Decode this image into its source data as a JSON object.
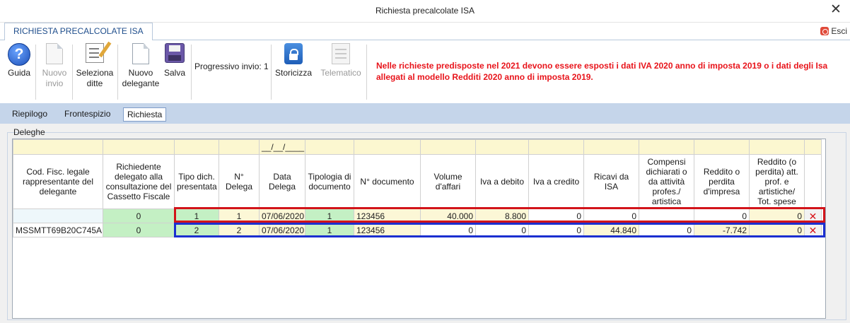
{
  "window": {
    "title": "Richiesta precalcolate ISA",
    "close_glyph": "✕"
  },
  "ribbon_tab": "RICHIESTA PRECALCOLATE ISA",
  "exit_label": "Esci",
  "toolbar": {
    "guida": "Guida",
    "nuovo_invio": [
      "Nuovo",
      "invio"
    ],
    "seleziona_ditte": [
      "Seleziona",
      "ditte"
    ],
    "nuovo_delegante": [
      "Nuovo",
      "delegante"
    ],
    "salva": "Salva",
    "progressivo": "Progressivo invio: 1",
    "storicizza": "Storicizza",
    "telematico": "Telematico"
  },
  "warning": "Nelle richieste predisposte nel 2021 devono essere esposti i dati IVA 2020 anno di imposta 2019 o i dati degli Isa allegati al modello Redditi 2020 anno di imposta 2019.",
  "tabs": [
    "Riepilogo",
    "Frontespizio",
    "Richiesta"
  ],
  "active_tab": "Richiesta",
  "group_title": "Deleghe",
  "grid": {
    "date_filter_mask": "__/__/____",
    "headers": [
      "Cod. Fisc. legale rappresentante del delegante",
      "Richiedente delegato alla consultazione del Cassetto Fiscale",
      "Tipo dich. presentata",
      "N° Delega",
      "Data Delega",
      "Tipologia di documento",
      "N° documento",
      "Volume d'affari",
      "Iva a debito",
      "Iva a credito",
      "Ricavi da ISA",
      "Compensi dichiarati o da attività profes./ artistica",
      "Reddito o perdita d'impresa",
      "Reddito (o perdita) att. prof. e artistiche/ Tot. spese"
    ],
    "rows": [
      {
        "cod_fisc": "",
        "richiedente": "0",
        "tipo_dich": "1",
        "n_delega": "1",
        "data_delega": "07/06/2020",
        "tipologia": "1",
        "n_documento": "123456",
        "volume_affari": "40.000",
        "iva_debito": "8.800",
        "iva_credito": "0",
        "ricavi_isa": "0",
        "compensi": "",
        "reddito_impresa": "0",
        "reddito_prof": "0",
        "delete_glyph": "✕"
      },
      {
        "cod_fisc": "MSSMTT69B20C745A",
        "richiedente": "0",
        "tipo_dich": "2",
        "n_delega": "2",
        "data_delega": "07/06/2020",
        "tipologia": "1",
        "n_documento": "123456",
        "volume_affari": "0",
        "iva_debito": "0",
        "iva_credito": "0",
        "ricavi_isa": "44.840",
        "compensi": "0",
        "reddito_impresa": "-7.742",
        "reddito_prof": "0",
        "delete_glyph": "✕"
      }
    ]
  },
  "highlight_colors": {
    "row_1": "#d2141a",
    "row_2": "#1b2fd0"
  }
}
